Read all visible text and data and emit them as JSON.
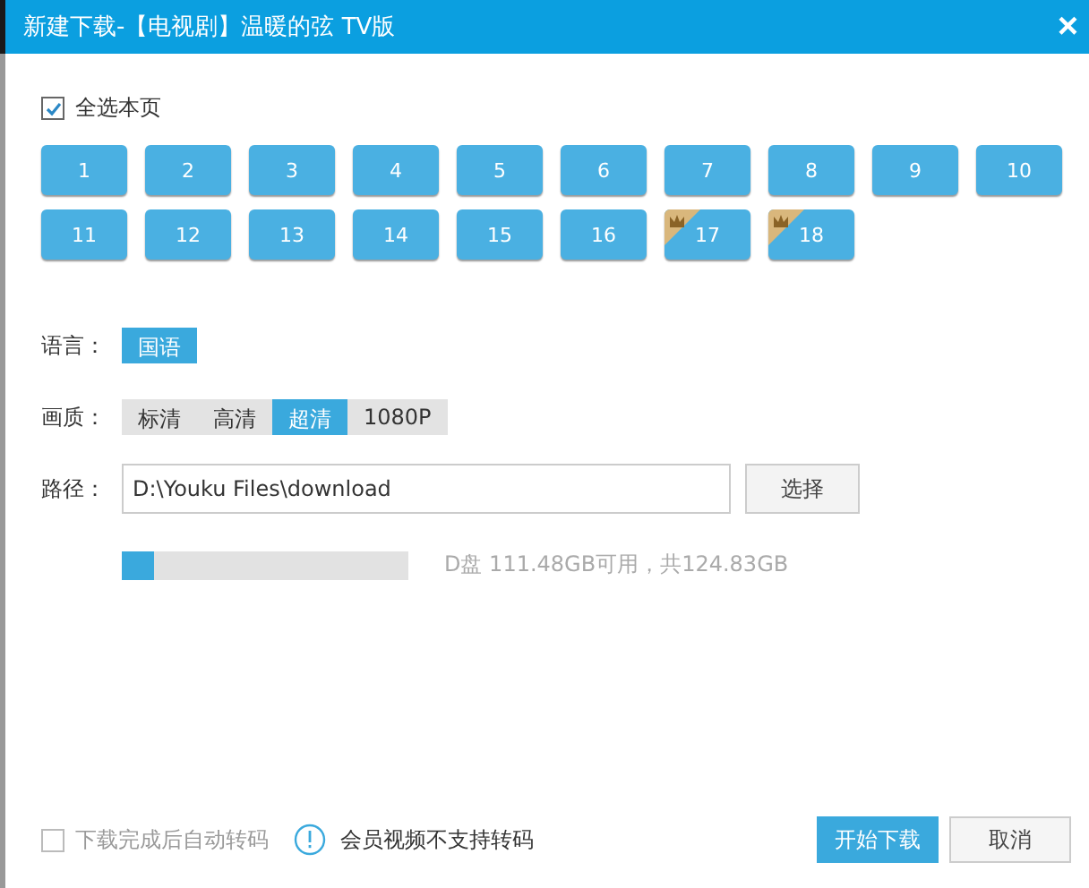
{
  "window": {
    "title": "新建下载-【电视剧】温暖的弦 TV版",
    "close": "×"
  },
  "select_all": {
    "label": "全选本页",
    "checked": true
  },
  "episodes": [
    {
      "label": "1",
      "selected": true,
      "vip": false
    },
    {
      "label": "2",
      "selected": true,
      "vip": false
    },
    {
      "label": "3",
      "selected": true,
      "vip": false
    },
    {
      "label": "4",
      "selected": true,
      "vip": false
    },
    {
      "label": "5",
      "selected": true,
      "vip": false
    },
    {
      "label": "6",
      "selected": true,
      "vip": false
    },
    {
      "label": "7",
      "selected": true,
      "vip": false
    },
    {
      "label": "8",
      "selected": true,
      "vip": false
    },
    {
      "label": "9",
      "selected": true,
      "vip": false
    },
    {
      "label": "10",
      "selected": true,
      "vip": false
    },
    {
      "label": "11",
      "selected": true,
      "vip": false
    },
    {
      "label": "12",
      "selected": true,
      "vip": false
    },
    {
      "label": "13",
      "selected": true,
      "vip": false
    },
    {
      "label": "14",
      "selected": true,
      "vip": false
    },
    {
      "label": "15",
      "selected": true,
      "vip": false
    },
    {
      "label": "16",
      "selected": true,
      "vip": false
    },
    {
      "label": "17",
      "selected": true,
      "vip": true
    },
    {
      "label": "18",
      "selected": true,
      "vip": true
    }
  ],
  "language": {
    "label": "语言：",
    "options": [
      {
        "label": "国语",
        "selected": true
      }
    ]
  },
  "quality": {
    "label": "画质：",
    "options": [
      {
        "label": "标清",
        "selected": false
      },
      {
        "label": "高清",
        "selected": false
      },
      {
        "label": "超清",
        "selected": true
      },
      {
        "label": "1080P",
        "selected": false
      }
    ]
  },
  "path": {
    "label": "路径：",
    "value": "D:\\Youku Files\\download",
    "button": "选择"
  },
  "disk": {
    "level": 0.11,
    "text": "D盘 111.48GB可用，共124.83GB"
  },
  "footer": {
    "transcode": {
      "label": "下载完成后自动转码",
      "checked": false,
      "disabled": true
    },
    "note": "会员视频不支持转码",
    "buttons": [
      {
        "label": "开始下载",
        "kind": "primary"
      },
      {
        "label": "取消",
        "kind": "secondary"
      }
    ]
  }
}
